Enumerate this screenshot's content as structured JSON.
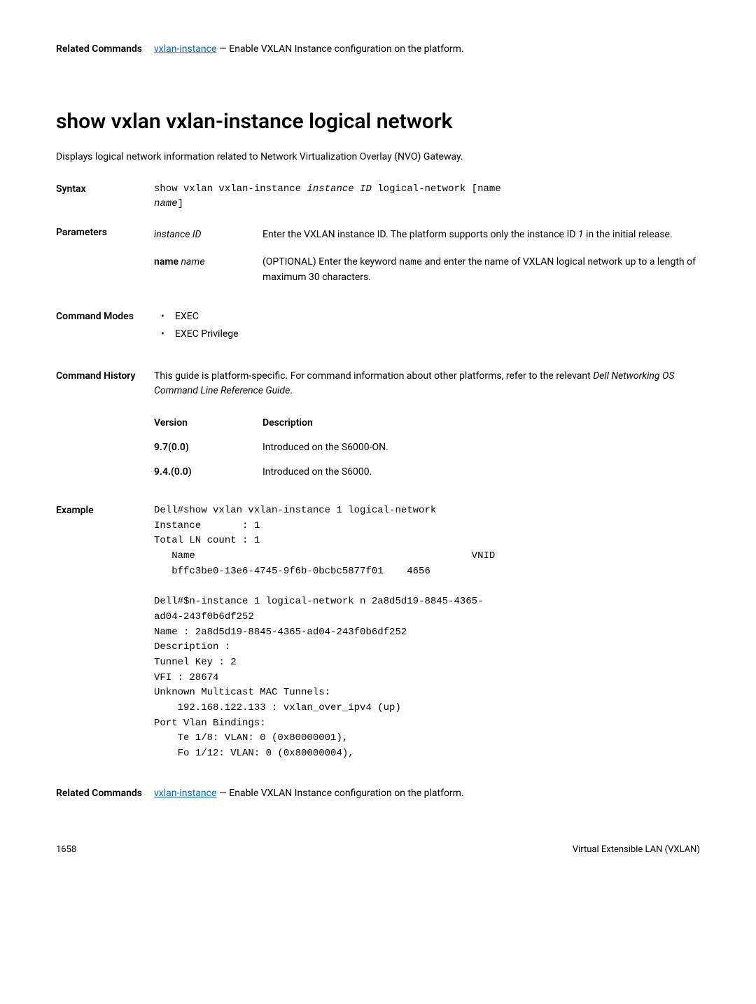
{
  "topRelated": {
    "label": "Related Commands",
    "link": "vxlan-instance",
    "text": " — Enable VXLAN Instance configuration on the platform."
  },
  "title": "show vxlan vxlan-instance logical network",
  "intro": "Displays logical network information related to Network Virtualization Overlay (NVO) Gateway.",
  "syntax": {
    "label": "Syntax",
    "command_pre": "show vxlan vxlan-instance ",
    "command_italic": "instance ID",
    "command_post": " logical-network [name ",
    "command_italic2": "name",
    "command_close": "]"
  },
  "parameters": {
    "label": "Parameters",
    "rows": [
      {
        "name_italic": "instance ID",
        "desc_pre": "Enter the VXLAN instance ID. The platform supports only the instance ID ",
        "desc_italic": "1",
        "desc_post": " in the initial release."
      },
      {
        "name_bold": "name",
        "name_italic": "name",
        "desc_pre": "(OPTIONAL) Enter the keyword ",
        "desc_mono": "name",
        "desc_post": " and enter the name of VXLAN logical network up to a length of maximum 30 characters."
      }
    ]
  },
  "modes": {
    "label": "Command Modes",
    "items": [
      "EXEC",
      "EXEC Privilege"
    ]
  },
  "history": {
    "label": "Command History",
    "intro_pre": "This guide is platform-specific. For command information about other platforms, refer to the relevant ",
    "intro_italic": "Dell Networking OS Command Line Reference Guide",
    "intro_post": ".",
    "header_version": "Version",
    "header_desc": "Description",
    "rows": [
      {
        "version": "9.7(0.0)",
        "desc": "Introduced on the S6000-ON."
      },
      {
        "version": "9.4.(0.0)",
        "desc": "Introduced on the S6000."
      }
    ]
  },
  "example": {
    "label": "Example",
    "block": "Dell#show vxlan vxlan-instance 1 logical-network\nInstance       : 1\nTotal LN count : 1\n   Name                                               VNID\n   bffc3be0-13e6-4745-9f6b-0bcbc5877f01    4656\n\nDell#$n-instance 1 logical-network n 2a8d5d19-8845-4365-\nad04-243f0b6df252\nName : 2a8d5d19-8845-4365-ad04-243f0b6df252\nDescription :\nTunnel Key : 2\nVFI : 28674\nUnknown Multicast MAC Tunnels:\n    192.168.122.133 : vxlan_over_ipv4 (up)\nPort Vlan Bindings:\n    Te 1/8: VLAN: 0 (0x80000001),\n    Fo 1/12: VLAN: 0 (0x80000004),"
  },
  "bottomRelated": {
    "label": "Related Commands",
    "link": "vxlan-instance",
    "text": " — Enable VXLAN Instance configuration on the platform."
  },
  "footer": {
    "page": "1658",
    "title": "Virtual Extensible LAN (VXLAN)"
  }
}
